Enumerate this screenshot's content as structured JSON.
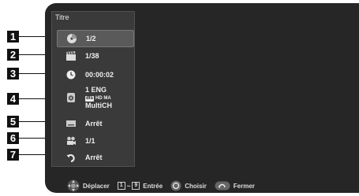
{
  "menu": {
    "title": "Titre",
    "items": [
      {
        "number": "1",
        "icon": "disc-icon",
        "value": "1/2"
      },
      {
        "number": "2",
        "icon": "clapperboard-icon",
        "value": "1/38"
      },
      {
        "number": "3",
        "icon": "clock-icon",
        "value": "00:00:02"
      },
      {
        "number": "4",
        "icon": "speaker-icon",
        "value_line1": "1 ENG",
        "value_badge": "dts",
        "value_badge_suffix": "HD MA",
        "value_line3": "MultiCH"
      },
      {
        "number": "5",
        "icon": "subtitle-icon",
        "value": "Arrêt"
      },
      {
        "number": "6",
        "icon": "camera-angle-icon",
        "value": "1/1"
      },
      {
        "number": "7",
        "icon": "repeat-icon",
        "value": "Arrêt"
      }
    ]
  },
  "footer": {
    "move_label": "Déplacer",
    "key_start": "1",
    "key_end": "9",
    "enter_label": "Entrée",
    "choose_label": "Choisir",
    "close_label": "Fermer"
  },
  "colors": {
    "screen_bg": "#262626",
    "panel_bg": "#3a3a3a",
    "selected_bg": "#5a5a5a",
    "callout_box": "#111111"
  }
}
